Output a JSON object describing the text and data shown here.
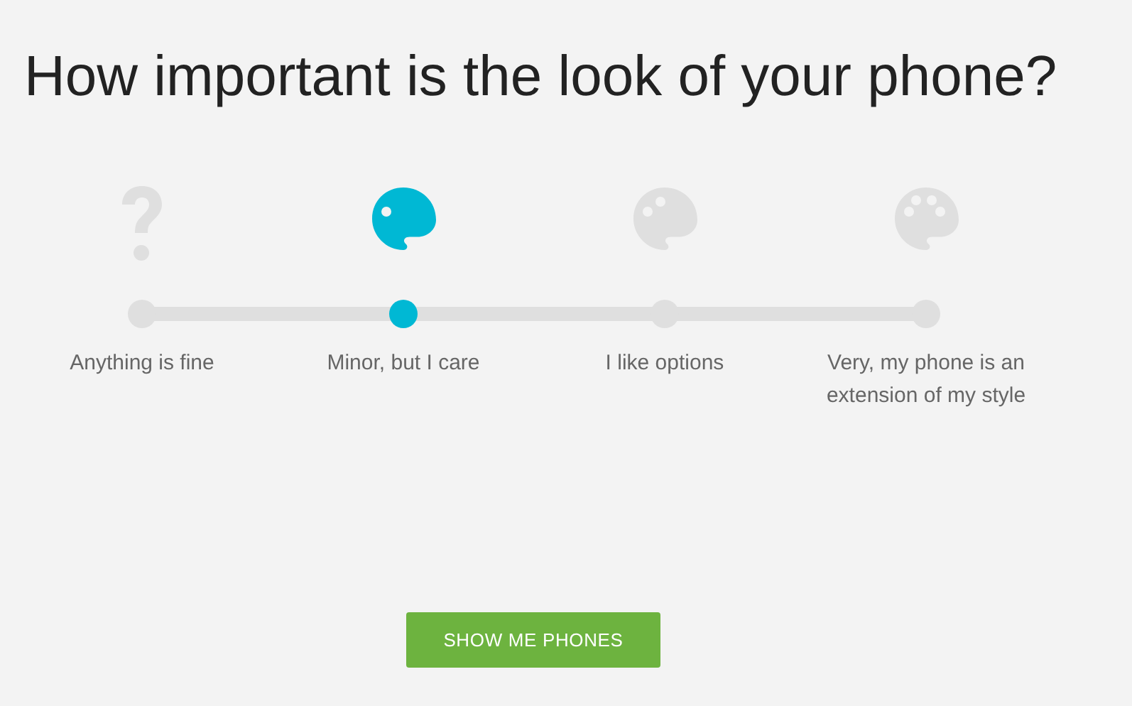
{
  "question": "How important is the look of your phone?",
  "options": [
    {
      "kind": "question",
      "label": "Anything is fine",
      "selected": false
    },
    {
      "kind": "palette-one",
      "label": "Minor, but I care",
      "selected": true
    },
    {
      "kind": "palette-two",
      "label": "I like options",
      "selected": false
    },
    {
      "kind": "palette-four",
      "label": "Very, my phone is an extension of my style",
      "selected": false
    }
  ],
  "button": "SHOW ME PHONES"
}
